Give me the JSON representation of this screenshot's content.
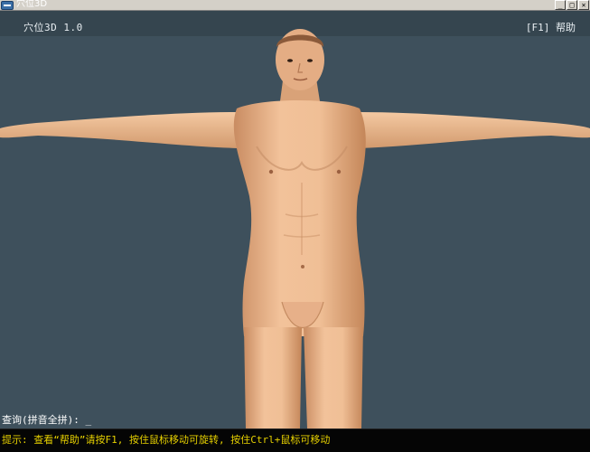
{
  "window": {
    "title": "穴位3D",
    "minimize_glyph": "_",
    "maximize_glyph": "□",
    "close_glyph": "✕"
  },
  "viewport": {
    "app_title": "穴位3D 1.0",
    "help_hint": "[F1] 帮助",
    "query_label": "查询(拼音全拼):",
    "query_value": "_"
  },
  "status": {
    "hint": "提示: 查看“帮助”请按F1, 按住鼠标移动可旋转, 按住Ctrl+鼠标可移动"
  },
  "colors": {
    "viewport_bg": "#3e505c",
    "skin": "#e8b38a",
    "status_text": "#e6d000"
  },
  "icons": {
    "app": "app-icon",
    "minimize": "minimize-icon",
    "maximize": "maximize-icon",
    "close": "close-icon"
  }
}
